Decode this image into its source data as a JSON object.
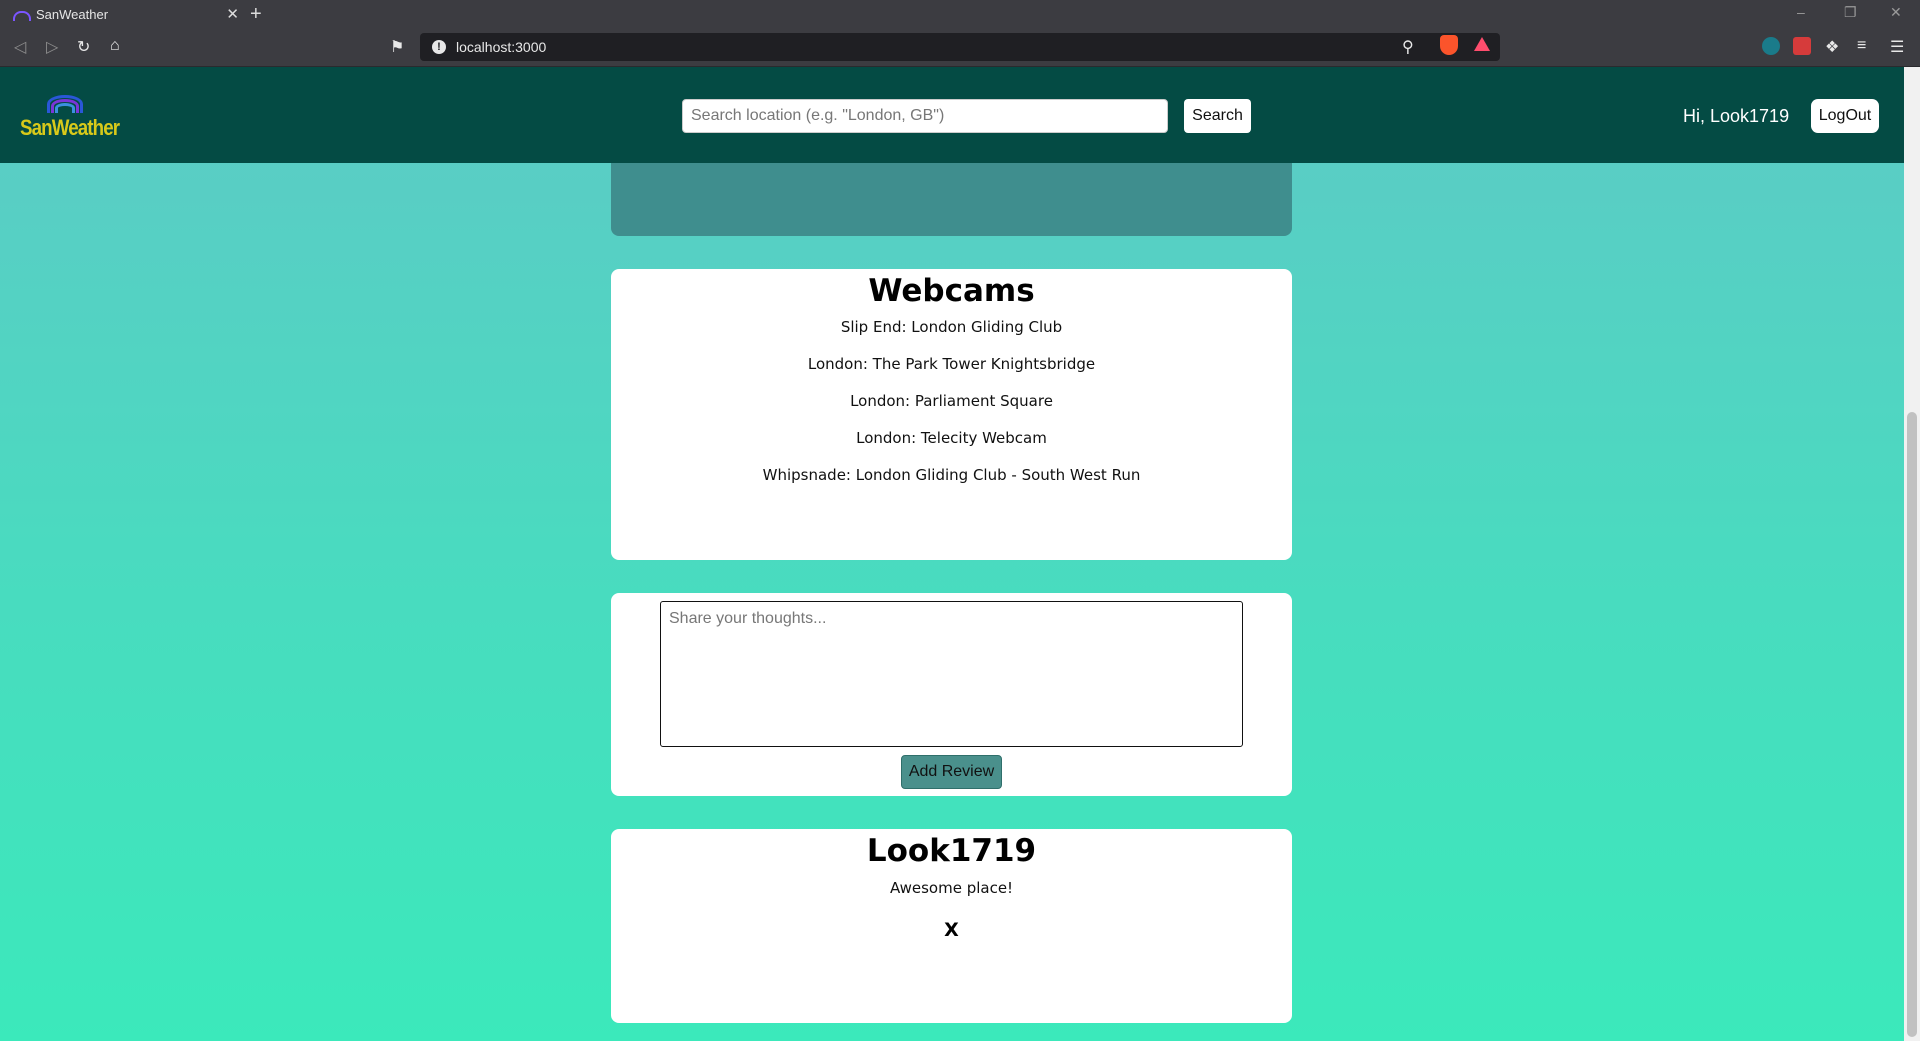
{
  "browser": {
    "tab_title": "SanWeather",
    "tab_close": "✕",
    "new_tab": "+",
    "url": "localhost:3000"
  },
  "header": {
    "logo_text": "SanWeather",
    "search_placeholder": "Search location (e.g. \"London, GB\")",
    "search_label": "Search",
    "greeting": "Hi, Look1719",
    "logout_label": "LogOut"
  },
  "webcams": {
    "title": "Webcams",
    "items": [
      "Slip End: London Gliding Club",
      "London: The Park Tower Knightsbridge",
      "London: Parliament Square",
      "London: Telecity Webcam",
      "Whipsnade: London Gliding Club - South West Run"
    ]
  },
  "review_form": {
    "placeholder": "Share your thoughts...",
    "submit_label": "Add Review"
  },
  "reviews": [
    {
      "author": "Look1719",
      "text": "Awesome place!",
      "delete_label": "X"
    }
  ],
  "colors": {
    "header_bg": "#044b44",
    "page_gradient_top": "#5dcac6",
    "page_gradient_bottom": "#3be9bb",
    "logo_text": "#d8c91a",
    "add_review_bg": "#4a908c"
  }
}
